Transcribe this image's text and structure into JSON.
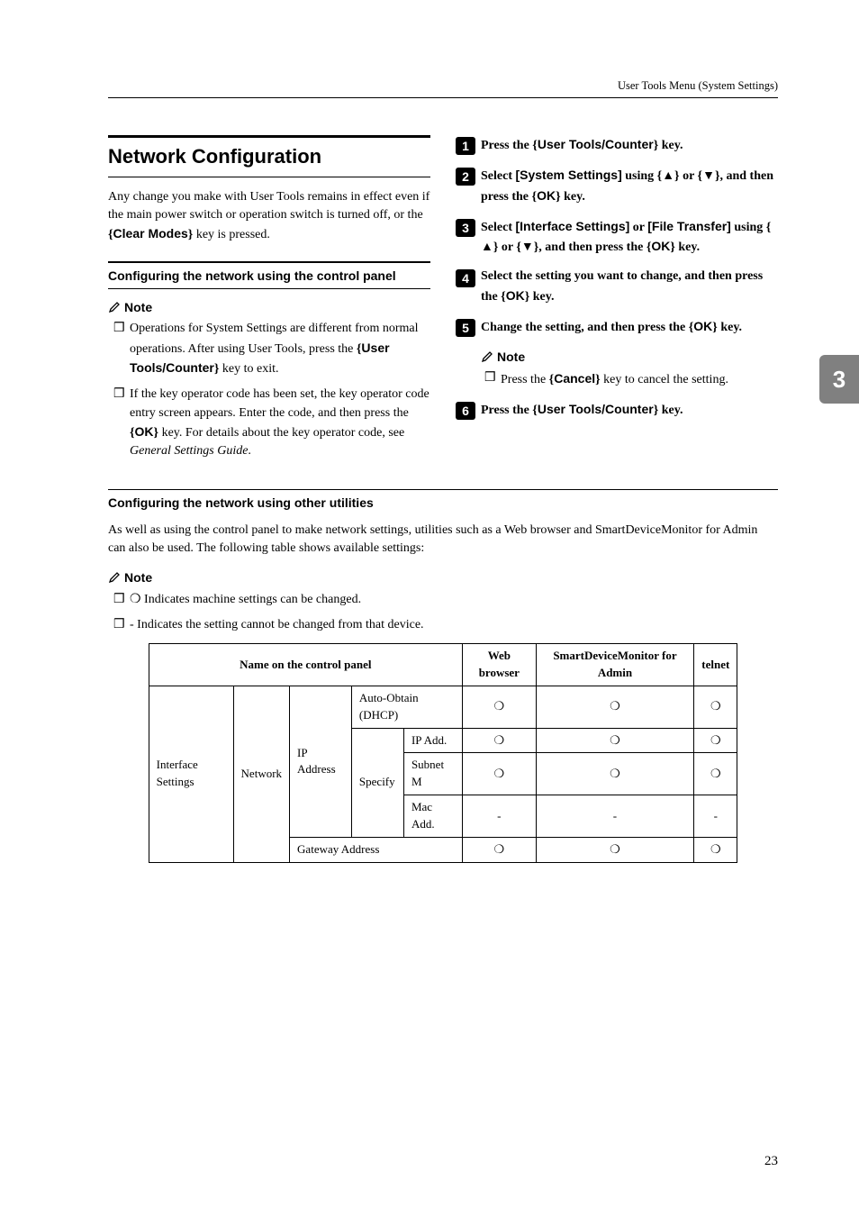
{
  "header": {
    "running": "User Tools Menu (System Settings)"
  },
  "side_tab": "3",
  "page_number": "23",
  "left": {
    "title": "Network Configuration",
    "intro_parts": {
      "p1": "Any change you make with User Tools remains in effect even if the main power switch or operation switch is turned off, or the ",
      "key1": "Clear Modes",
      "p2": " key is pressed."
    },
    "sub_title": "Configuring the network using the control panel",
    "note_label": "Note",
    "bullets": {
      "b1": {
        "t1": "Operations for System Settings are different from normal operations. After using User Tools, press the ",
        "key": "User Tools/Counter",
        "t2": " key to exit."
      },
      "b2": {
        "t1": "If the key operator code has been set, the key operator code entry screen appears. Enter the code, and then press the ",
        "key": "OK",
        "t2": " key. For details about the key operator code, see ",
        "ital": "General Settings Guide",
        "t3": "."
      }
    }
  },
  "right": {
    "steps": {
      "s1": {
        "t1": "Press the ",
        "key": "User Tools/Counter",
        "t2": " key."
      },
      "s2": {
        "t1": "Select ",
        "bold": "[System Settings]",
        "t2": " using ",
        "t3": " or ",
        "t4": ", and then press the ",
        "key": "OK",
        "t5": " key."
      },
      "s3": {
        "t1": "Select ",
        "bold1": "[Interface Settings]",
        "t2": " or ",
        "bold2": "[File Transfer]",
        "t3": " using ",
        "t4": " or ",
        "t5": ", and then press the ",
        "key": "OK",
        "t6": " key."
      },
      "s4": {
        "t1": "Select the setting you want to change, and then press the ",
        "key": "OK",
        "t2": " key."
      },
      "s5": {
        "t1": "Change the setting, and then press the ",
        "key": "OK",
        "t2": " key."
      },
      "note_label": "Note",
      "s5_note": {
        "t1": "Press the ",
        "key": "Cancel",
        "t2": " key to cancel the setting."
      },
      "s6": {
        "t1": "Press the ",
        "key": "User Tools/Counter",
        "t2": " key."
      }
    }
  },
  "lower": {
    "title": "Configuring the network using other utilities",
    "para": "As well as using the control panel to make network settings, utilities such as a Web browser and SmartDeviceMonitor for Admin can also be used. The following table shows available settings:",
    "note_label": "Note",
    "note_items": {
      "n1": "❍ Indicates machine settings can be changed.",
      "n2": "- Indicates the setting cannot be changed from that device."
    }
  },
  "chart_data": {
    "type": "table",
    "columns": [
      "Name on the control panel",
      "Web browser",
      "SmartDeviceMonitor for Admin",
      "telnet"
    ],
    "rows": [
      {
        "name": [
          "Interface Settings",
          "Network",
          "IP Address",
          "Auto-Obtain (DHCP)"
        ],
        "web": "❍",
        "sdm": "❍",
        "telnet": "❍"
      },
      {
        "name": [
          "Interface Settings",
          "Network",
          "IP Address",
          "Specify",
          "IP Add."
        ],
        "web": "❍",
        "sdm": "❍",
        "telnet": "❍"
      },
      {
        "name": [
          "Interface Settings",
          "Network",
          "IP Address",
          "Specify",
          "Subnet M"
        ],
        "web": "❍",
        "sdm": "❍",
        "telnet": "❍"
      },
      {
        "name": [
          "Interface Settings",
          "Network",
          "IP Address",
          "Specify",
          "Mac Add."
        ],
        "web": "-",
        "sdm": "-",
        "telnet": "-"
      },
      {
        "name": [
          "Interface Settings",
          "Network",
          "Gateway Address"
        ],
        "web": "❍",
        "sdm": "❍",
        "telnet": "❍"
      }
    ],
    "headers": {
      "name": "Name on the control panel",
      "web": "Web browser",
      "sdm": "SmartDeviceMonitor for Admin",
      "telnet": "telnet"
    },
    "row_labels": {
      "iface": "Interface Settings",
      "net": "Network",
      "ip": "IP Address",
      "auto": "Auto-Obtain (DHCP)",
      "spec": "Specify",
      "ipadd": "IP Add.",
      "subnet": "Subnet M",
      "mac": "Mac Add.",
      "gw": "Gateway Address"
    },
    "marks": {
      "yes": "❍",
      "no": "-"
    }
  }
}
